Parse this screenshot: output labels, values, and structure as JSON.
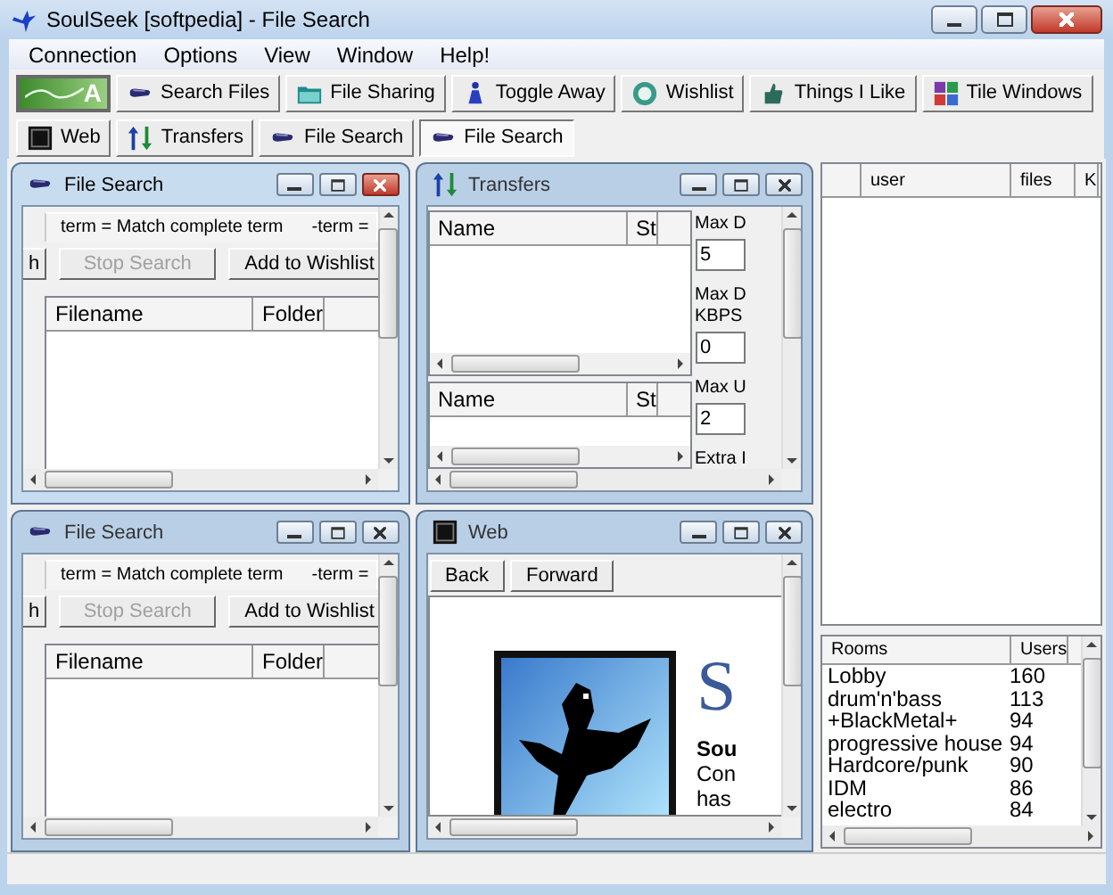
{
  "window": {
    "title": "SoulSeek [softpedia] - File Search"
  },
  "menu": [
    "Connection",
    "Options",
    "View",
    "Window",
    "Help!"
  ],
  "toolbar": {
    "logo_text": "A",
    "buttons": [
      {
        "label": "Search Files"
      },
      {
        "label": "File Sharing"
      },
      {
        "label": "Toggle Away"
      },
      {
        "label": "Wishlist"
      },
      {
        "label": "Things I Like"
      },
      {
        "label": "Tile Windows"
      }
    ]
  },
  "tabs": [
    {
      "label": "Web",
      "selected": false
    },
    {
      "label": "Transfers",
      "selected": false
    },
    {
      "label": "File Search",
      "selected": false
    },
    {
      "label": "File Search",
      "selected": true
    }
  ],
  "windows": [
    {
      "kind": "search",
      "title": "File Search",
      "active": true,
      "hint": [
        "term = Match complete term",
        "-term ="
      ],
      "buttons": [
        {
          "label": "h",
          "disabled": false
        },
        {
          "label": "Stop Search",
          "disabled": true
        },
        {
          "label": "Add to Wishlist",
          "disabled": false
        }
      ],
      "columns": [
        "Filename",
        "Folder"
      ]
    },
    {
      "kind": "transfers",
      "title": "Transfers",
      "active": false,
      "lists": [
        {
          "columns": [
            "Name",
            "St"
          ]
        },
        {
          "columns": [
            "Name",
            "St"
          ]
        }
      ],
      "settings": [
        {
          "label": [
            "Max D"
          ],
          "value": "5"
        },
        {
          "label": [
            "Max D",
            "KBPS"
          ],
          "value": "0"
        },
        {
          "label": [
            "Max U"
          ],
          "value": "2"
        },
        {
          "label": [
            "Extra I"
          ]
        }
      ]
    },
    {
      "kind": "search",
      "title": "File Search",
      "active": false,
      "hint": [
        "term = Match complete term",
        "-term ="
      ],
      "buttons": [
        {
          "label": "h",
          "disabled": false
        },
        {
          "label": "Stop Search",
          "disabled": true
        },
        {
          "label": "Add to Wishlist",
          "disabled": false
        }
      ],
      "columns": [
        "Filename",
        "Folder"
      ]
    },
    {
      "kind": "web",
      "title": "Web",
      "active": false,
      "buttons": [
        "Back",
        "Forward"
      ],
      "page": {
        "heading": "S",
        "bold": "Sou",
        "lines": [
          "Con",
          "has"
        ]
      }
    }
  ],
  "users": {
    "columns": [
      "user",
      "files",
      "K"
    ]
  },
  "rooms": {
    "columns": [
      "Rooms",
      "Users"
    ],
    "rows": [
      {
        "name": "Lobby",
        "users": "160"
      },
      {
        "name": "drum'n'bass",
        "users": "113"
      },
      {
        "name": "+BlackMetal+",
        "users": "94"
      },
      {
        "name": "progressive house",
        "users": "94"
      },
      {
        "name": "Hardcore/punk",
        "users": "90"
      },
      {
        "name": "IDM",
        "users": "86"
      },
      {
        "name": "electro",
        "users": "84"
      }
    ]
  }
}
